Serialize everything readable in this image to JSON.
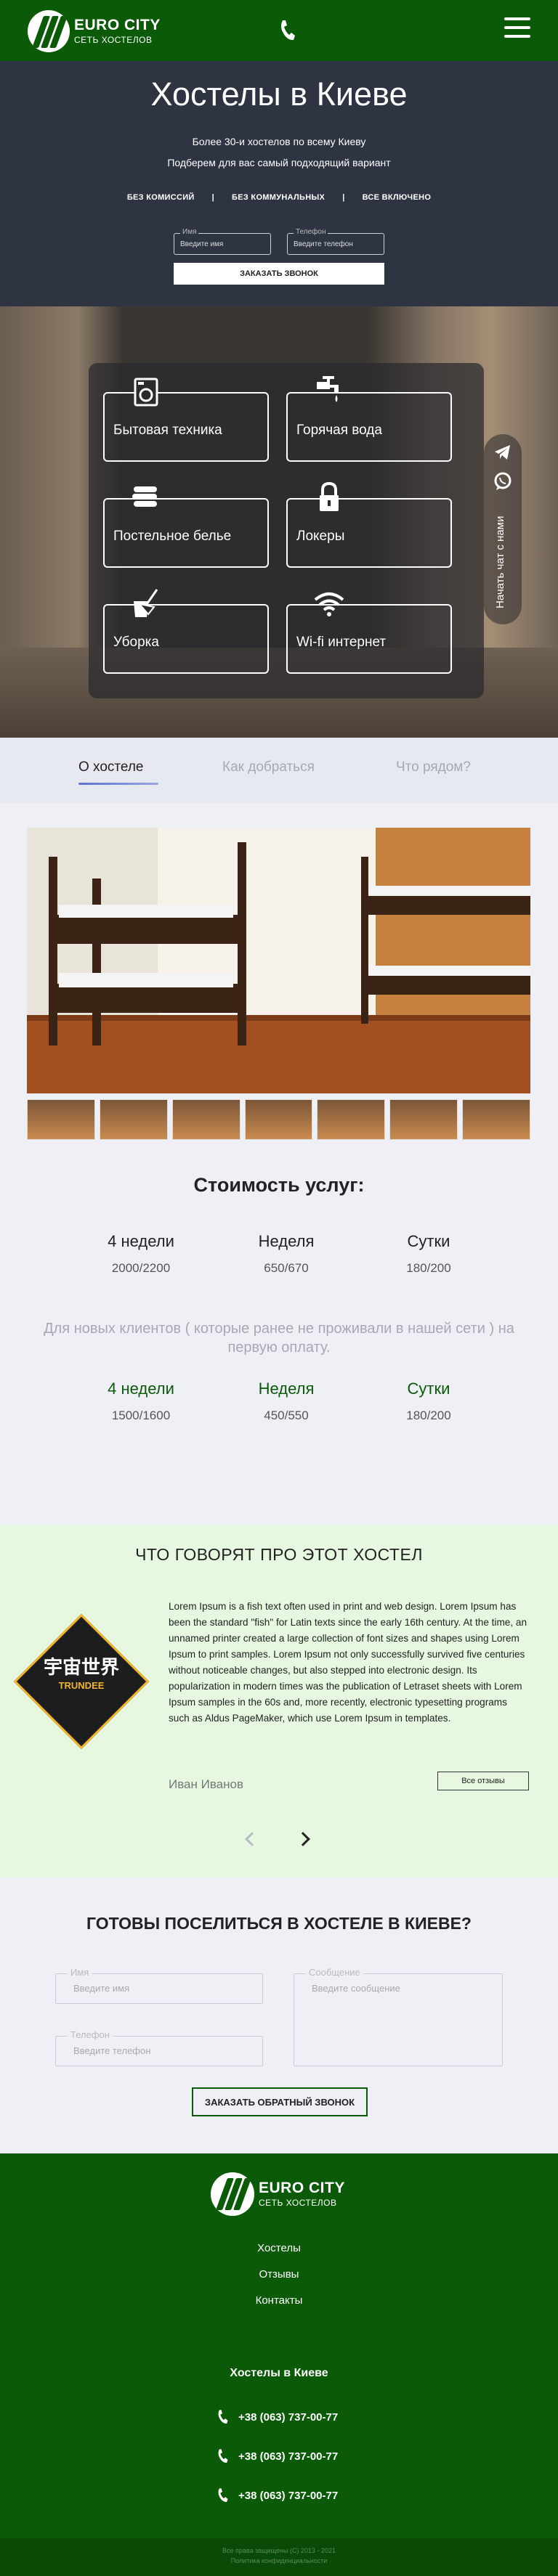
{
  "header": {
    "logo_title": "EURO CITY",
    "logo_subtitle": "СЕТЬ ХОСТЕЛОВ",
    "phone_icon": "phone-icon",
    "menu_icon": "burger-menu-icon"
  },
  "hero": {
    "title": "Хостелы в Киеве",
    "subtitle_1": "Более 30-и хостелов по всему Киеву",
    "subtitle_2": "Подберем для вас самый подходящий вариант",
    "features": [
      "БЕЗ КОМИССИЙ",
      "|",
      "БЕЗ КОММУНАЛЬНЫХ",
      "|",
      "ВСЕ ВКЛЮЧЕНО"
    ],
    "name_label": "Имя",
    "name_placeholder": "Введите имя",
    "phone_label": "Телефон",
    "phone_placeholder": "Введите телефон",
    "submit": "ЗАКАЗАТЬ ЗВОНОК"
  },
  "amenities": [
    {
      "label": "Бытовая техника",
      "icon": "appliances-icon"
    },
    {
      "label": "Горячая вода",
      "icon": "faucet-icon"
    },
    {
      "label": "Постельное белье",
      "icon": "linen-icon"
    },
    {
      "label": "Локеры",
      "icon": "lock-icon"
    },
    {
      "label": "Уборка",
      "icon": "cleaning-icon"
    },
    {
      "label": "Wi-fi интернет",
      "icon": "wifi-icon"
    }
  ],
  "side_chat": {
    "label": "Начать чат с нами",
    "icons": [
      "telegram-icon",
      "viber-icon"
    ]
  },
  "tabs": [
    {
      "label": "О хостеле",
      "active": true
    },
    {
      "label": "Как добраться",
      "active": false
    },
    {
      "label": "Что рядом?",
      "active": false
    }
  ],
  "prices": {
    "title": "Стоимость услуг:",
    "regular": [
      {
        "period": "4 недели",
        "value": "2000/2200"
      },
      {
        "period": "Неделя",
        "value": "650/670"
      },
      {
        "period": "Сутки",
        "value": "180/200"
      }
    ],
    "new_clients_note": "Для новых клиентов ( которые ранее не проживали в нашей сети ) на первую оплату.",
    "new_clients": [
      {
        "period": "4 недели",
        "value": "1500/1600"
      },
      {
        "period": "Неделя",
        "value": "450/550"
      },
      {
        "period": "Сутки",
        "value": "180/200"
      }
    ]
  },
  "reviews": {
    "title": "ЧТО ГОВОРЯТ ПРО ЭТОТ ХОСТЕЛ",
    "logo_text": "宇宙世界",
    "logo_sub": "TRUNDEE",
    "text": "Lorem Ipsum is a fish text often used in print and web design. Lorem Ipsum has been the standard \"fish\" for Latin texts since the early 16th century. At the time, an unnamed printer created a large collection of font sizes and shapes using Lorem Ipsum to print samples. Lorem Ipsum not only successfully survived five centuries without noticeable changes, but also stepped into electronic design. Its popularization in modern times was the publication of Letraset sheets with Lorem Ipsum samples in the 60s and, more recently, electronic typesetting programs such as Aldus PageMaker, which use Lorem Ipsum in templates.",
    "author": "Иван Иванов",
    "all_button": "Все отзывы"
  },
  "contact_form": {
    "title": "ГОТОВЫ ПОСЕЛИТЬСЯ В ХОСТЕЛЕ В КИЕВЕ?",
    "name_label": "Имя",
    "name_placeholder": "Введите имя",
    "phone_label": "Телефон",
    "phone_placeholder": "Введите телефон",
    "message_label": "Сообщение",
    "message_placeholder": "Введите сообщение",
    "submit": "ЗАКАЗАТЬ ОБРАТНЫЙ ЗВОНОК"
  },
  "footer": {
    "logo_title": "EURO CITY",
    "logo_subtitle": "СЕТЬ ХОСТЕЛОВ",
    "links": [
      "Хостелы",
      "Отзывы",
      "Контакты"
    ],
    "section_title": "Хостелы в Киеве",
    "phones": [
      "+38 (063) 737-00-77",
      "+38 (063) 737-00-77",
      "+38 (063) 737-00-77"
    ],
    "copyright": "Все права защищены (C) 2013 - 2021",
    "policy": "Политика конфиденциальности"
  },
  "colors": {
    "brand_green": "#0b5a08",
    "hero_bg": "#2f3443",
    "page_bg": "#eef0f6",
    "reviews_bg": "#e6f8df"
  }
}
